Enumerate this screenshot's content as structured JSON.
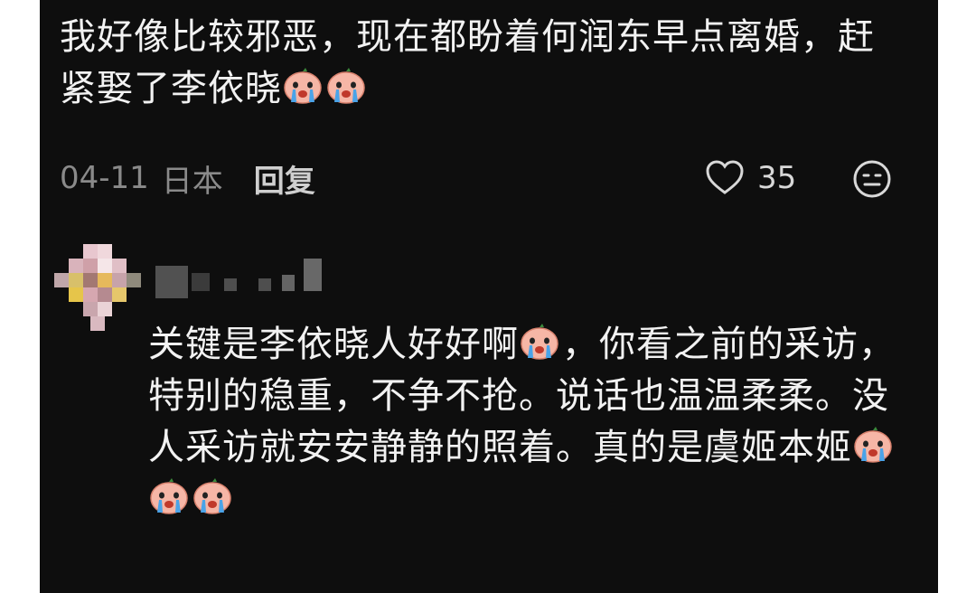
{
  "comments": [
    {
      "text": "我好像比较邪恶，现在都盼着何润东早点离婚，赶紧娶了李依晓",
      "emoji": "crying-face-emoji",
      "emoji_count": 2,
      "date": "04-11",
      "location": "日本",
      "reply_label": "回复",
      "like_count": "35"
    },
    {
      "text_parts": [
        "关键是李依晓人好好啊",
        "，你看之前的采访，特别的稳重，不争不抢。说话也温温柔柔。没人采访就安安静静的照着。真的是虞姬本姬"
      ],
      "emoji": "crying-face-emoji",
      "emoji_count_mid": 1,
      "emoji_count_end": 3
    }
  ],
  "icons": {
    "like": "heart-icon",
    "dislike": "meh-face-icon"
  },
  "colors": {
    "background": "#0e0e0e",
    "text": "#f2f2f2",
    "meta": "#8a8a8a"
  }
}
